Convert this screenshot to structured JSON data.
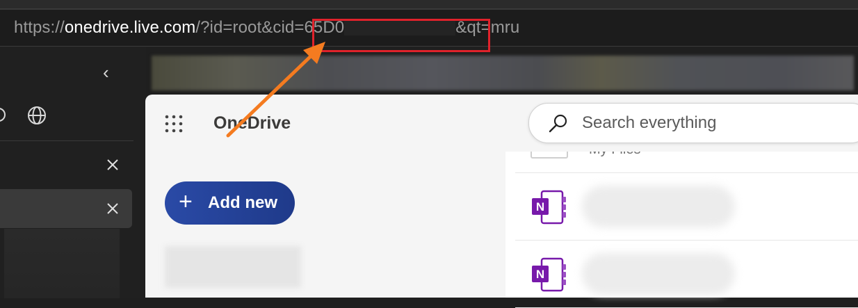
{
  "browser": {
    "url": {
      "prefix": "https://",
      "domain": "onedrive.live.com",
      "path_before": "/?id=root&cid=65D0",
      "path_after": "&qt=mru"
    },
    "highlight_color": "#e0222b",
    "arrow_color": "#f47b20"
  },
  "sidebar": {
    "collapse_icon": "chevron-left-icon",
    "collapse_glyph": "‹",
    "globe_icon": "globe-icon"
  },
  "onedrive": {
    "brand": "OneDrive",
    "search": {
      "placeholder": "Search everything"
    },
    "add_new": {
      "plus_glyph": "+",
      "label": "Add new"
    },
    "files": {
      "partial_label": "My Files",
      "rows": [
        {
          "icon": "onenote-icon",
          "icon_letter": "N"
        },
        {
          "icon": "onenote-icon",
          "icon_letter": "N"
        }
      ]
    },
    "accent": "#2a4aa6",
    "onenote_color": "#7719aa"
  }
}
